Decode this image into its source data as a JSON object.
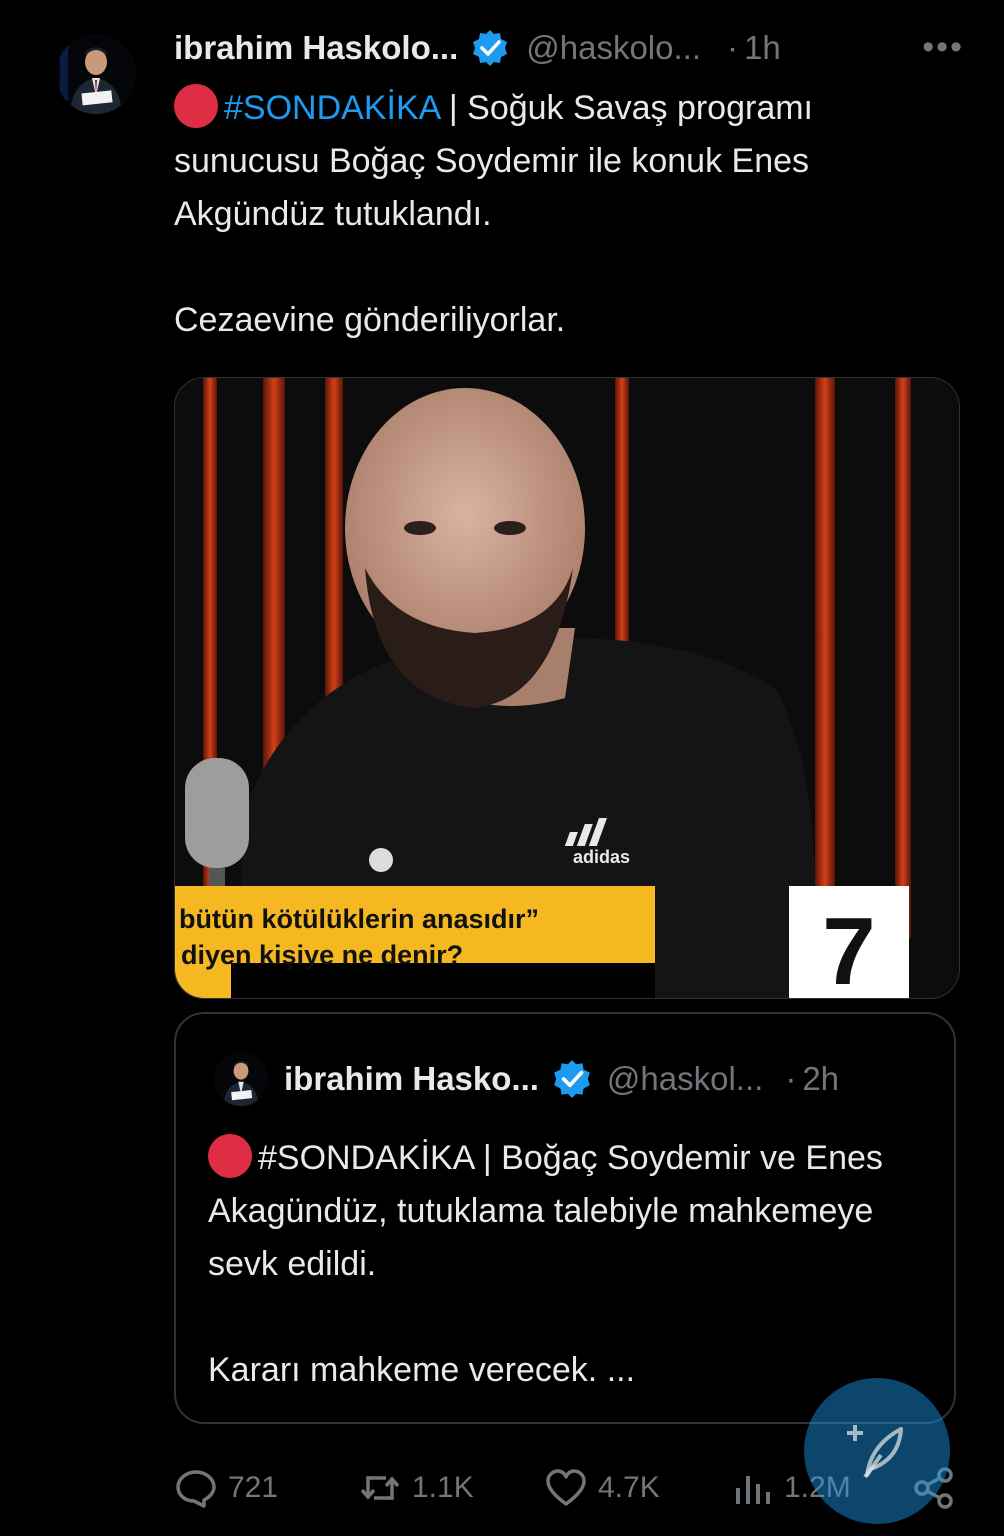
{
  "tweet": {
    "author_name": "ibrahim Haskolo...",
    "handle": "@haskolo...",
    "separator": "·",
    "time": "1h",
    "more_label": "•••",
    "hashtag": "#SONDAKİKA",
    "line1_rest": " | Soğuk Savaş programı sunucusu Boğaç Soydemir ile konuk Enes Akgündüz tutuklandı.",
    "line2": "Cezaevine gönderiliyorlar."
  },
  "media": {
    "caption_line1": "bütün kötülüklerin anasıdır”",
    "caption_line2": "diyen kişiye ne denir?",
    "shirt_brand": "adidas",
    "number_badge": "7"
  },
  "quote": {
    "author_name": "ibrahim Hasko...",
    "handle": "@haskol...",
    "separator": "·",
    "time": "2h",
    "hashtag": "#SONDAKİKA",
    "line1_rest": " | Boğaç Soydemir ve Enes Akagündüz, tutuklama talebiyle mahkemeye sevk edildi.",
    "line2": "Kararı mahkeme verecek. ..."
  },
  "actions": {
    "replies": "721",
    "reposts": "1.1K",
    "likes": "4.7K",
    "views": "1.2M"
  },
  "colors": {
    "background": "#000000",
    "text": "#e7e9ea",
    "muted": "#71767b",
    "accent": "#1d9bf0",
    "red": "#dd2e44",
    "caption_yellow": "#f5b820"
  },
  "icons": {
    "verified": "verified-badge-icon",
    "reply": "reply-icon",
    "repost": "repost-icon",
    "like": "like-icon",
    "views": "views-icon",
    "share": "share-icon",
    "compose": "compose-icon"
  }
}
